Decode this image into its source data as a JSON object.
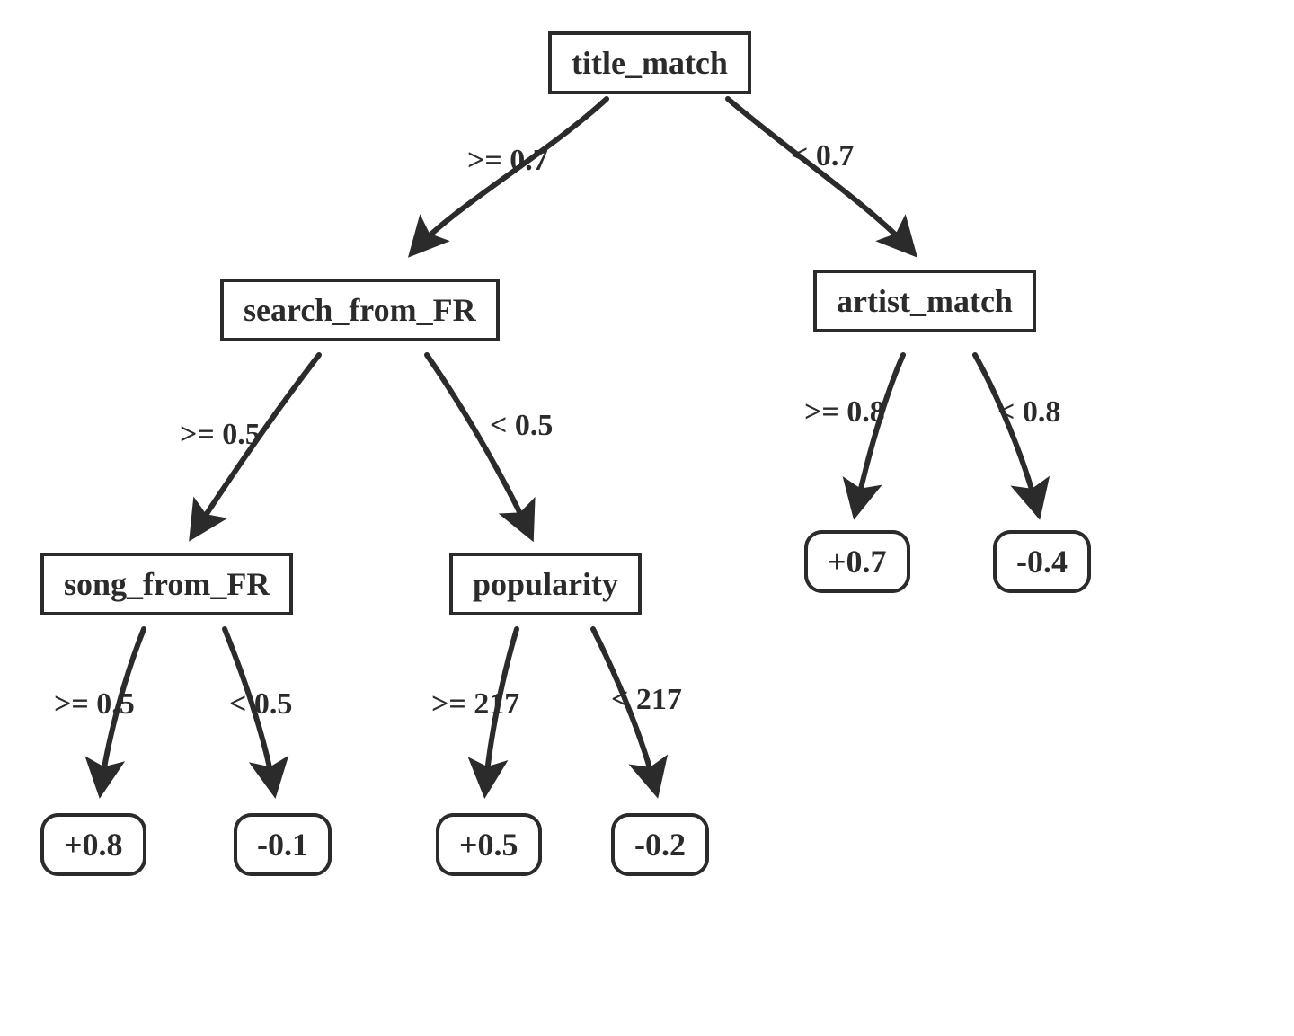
{
  "chart_data": {
    "type": "decision-tree",
    "root": {
      "feature": "title_match",
      "left": {
        "op": ">=",
        "threshold": 0.7,
        "node": {
          "feature": "search_from_FR",
          "left": {
            "op": ">=",
            "threshold": 0.5,
            "node": {
              "feature": "song_from_FR",
              "left": {
                "op": ">=",
                "threshold": 0.5,
                "leaf": 0.8
              },
              "right": {
                "op": "<",
                "threshold": 0.5,
                "leaf": -0.1
              }
            }
          },
          "right": {
            "op": "<",
            "threshold": 0.5,
            "node": {
              "feature": "popularity",
              "left": {
                "op": ">=",
                "threshold": 217,
                "leaf": 0.5
              },
              "right": {
                "op": "<",
                "threshold": 217,
                "leaf": -0.2
              }
            }
          }
        }
      },
      "right": {
        "op": "<",
        "threshold": 0.7,
        "node": {
          "feature": "artist_match",
          "left": {
            "op": ">=",
            "threshold": 0.8,
            "leaf": 0.7
          },
          "right": {
            "op": "<",
            "threshold": 0.8,
            "leaf": -0.4
          }
        }
      }
    }
  },
  "nodes": {
    "root": {
      "label": "title_match"
    },
    "n2": {
      "label": "search_from_FR"
    },
    "n3": {
      "label": "artist_match"
    },
    "n4": {
      "label": "song_from_FR"
    },
    "n5": {
      "label": "popularity"
    }
  },
  "leaves": {
    "l1": {
      "value": "+0.8"
    },
    "l2": {
      "value": "-0.1"
    },
    "l3": {
      "value": "+0.5"
    },
    "l4": {
      "value": "-0.2"
    },
    "l5": {
      "value": "+0.7"
    },
    "l6": {
      "value": "-0.4"
    }
  },
  "edges": {
    "e_root_n2": {
      "label": ">= 0.7"
    },
    "e_root_n3": {
      "label": "< 0.7"
    },
    "e_n2_n4": {
      "label": ">= 0.5"
    },
    "e_n2_n5": {
      "label": "< 0.5"
    },
    "e_n4_l1": {
      "label": ">= 0.5"
    },
    "e_n4_l2": {
      "label": "< 0.5"
    },
    "e_n5_l3": {
      "label": ">= 217"
    },
    "e_n5_l4": {
      "label": "< 217"
    },
    "e_n3_l5": {
      "label": ">= 0.8"
    },
    "e_n3_l6": {
      "label": "< 0.8"
    }
  }
}
